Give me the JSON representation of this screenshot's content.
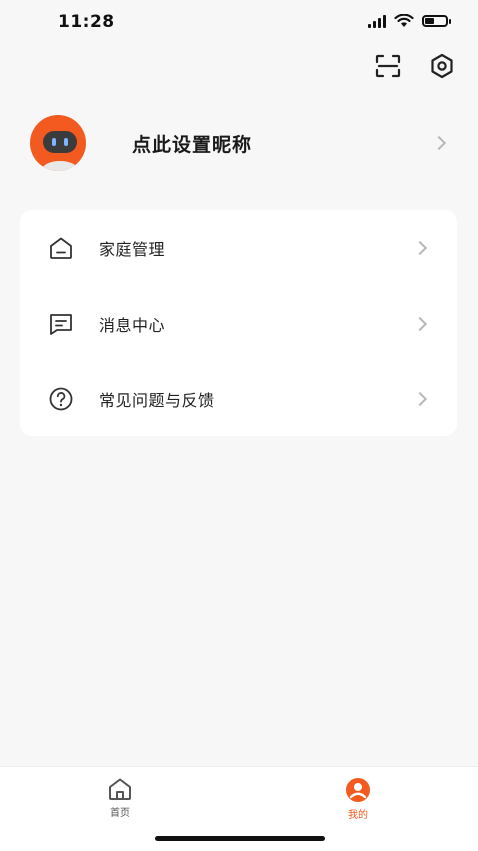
{
  "status_bar": {
    "time": "11:28",
    "battery_level": 0.45
  },
  "top_actions": {
    "scan_icon": "scan-icon",
    "settings_icon": "settings-hexagon-icon"
  },
  "profile": {
    "nickname_prompt": "点此设置昵称"
  },
  "menu": {
    "items": [
      {
        "label": "家庭管理",
        "icon": "house-icon"
      },
      {
        "label": "消息中心",
        "icon": "message-icon"
      },
      {
        "label": "常见问题与反馈",
        "icon": "help-circle-icon"
      }
    ]
  },
  "tab_bar": {
    "tabs": [
      {
        "label": "首页",
        "icon": "home-icon",
        "active": false
      },
      {
        "label": "我的",
        "icon": "user-icon",
        "active": true
      }
    ]
  },
  "colors": {
    "accent": "#f25a1f",
    "background": "#f7f7f7",
    "card": "#ffffff"
  }
}
